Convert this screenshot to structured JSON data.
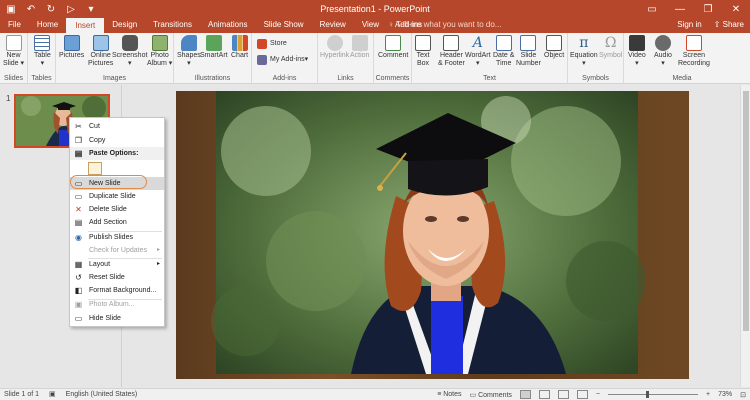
{
  "app": {
    "title": "Presentation1 - PowerPoint",
    "window_controls": [
      "—",
      "❐",
      "✕"
    ],
    "qat_icons": [
      "save-icon",
      "undo-icon",
      "redo-icon",
      "present-icon",
      "customize-icon"
    ]
  },
  "tabs": {
    "items": [
      "File",
      "Home",
      "Insert",
      "Design",
      "Transitions",
      "Animations",
      "Slide Show",
      "Review",
      "View",
      "Add-ins"
    ],
    "active": "Insert",
    "tell_me": "Tell me what you want to do...",
    "sign_in": "Sign in",
    "share": "Share"
  },
  "ribbon": {
    "slides": {
      "label": "Slides",
      "new_slide": "New",
      "new_slide2": "Slide ▾"
    },
    "tables": {
      "label": "Tables",
      "table": "Table",
      "table2": "▾"
    },
    "images": {
      "label": "Images",
      "pictures": "Pictures",
      "online": "Online",
      "online2": "Pictures",
      "screenshot": "Screenshot",
      "screenshot2": "▾",
      "album": "Photo",
      "album2": "Album ▾"
    },
    "illustrations": {
      "label": "Illustrations",
      "shapes": "Shapes",
      "shapes2": "▾",
      "smartart": "SmartArt",
      "chart": "Chart"
    },
    "addins": {
      "label": "Add-ins",
      "store": "Store",
      "myaddins": "My Add-ins"
    },
    "links": {
      "label": "Links",
      "hyperlink": "Hyperlink",
      "action": "Action"
    },
    "comments": {
      "label": "Comments",
      "comment": "Comment"
    },
    "text": {
      "label": "Text",
      "textbox": "Text",
      "textbox2": "Box",
      "header": "Header",
      "header2": "& Footer",
      "wordart": "WordArt",
      "wordart2": "▾",
      "date": "Date &",
      "date2": "Time",
      "slidenum": "Slide",
      "slidenum2": "Number",
      "object": "Object"
    },
    "symbols": {
      "label": "Symbols",
      "equation": "Equation",
      "equation2": "▾",
      "symbol": "Symbol",
      "pi": "π",
      "omega": "Ω"
    },
    "media": {
      "label": "Media",
      "video": "Video",
      "video2": "▾",
      "audio": "Audio",
      "audio2": "▾",
      "screenrec": "Screen",
      "screenrec2": "Recording"
    }
  },
  "thumbnails": {
    "number": "1"
  },
  "context_menu": {
    "items": [
      {
        "label": "Cut",
        "icon": "cut-icon",
        "glyph": "✂",
        "state": "normal"
      },
      {
        "label": "Copy",
        "icon": "copy-icon",
        "glyph": "❐",
        "state": "normal"
      },
      {
        "label": "Paste Options:",
        "icon": "paste-icon",
        "glyph": "📋",
        "state": "header"
      },
      {
        "label": "New Slide",
        "icon": "new-slide-icon",
        "glyph": "▭",
        "state": "highlighted"
      },
      {
        "label": "Duplicate Slide",
        "icon": "duplicate-slide-icon",
        "glyph": "▭",
        "state": "normal"
      },
      {
        "label": "Delete Slide",
        "icon": "delete-slide-icon",
        "glyph": "✕",
        "state": "normal"
      },
      {
        "label": "Add Section",
        "icon": "add-section-icon",
        "glyph": "▤",
        "state": "normal"
      },
      {
        "label": "Publish Slides",
        "icon": "publish-slides-icon",
        "glyph": "◉",
        "state": "normal"
      },
      {
        "label": "Check for Updates",
        "icon": "check-updates-icon",
        "glyph": "",
        "state": "disabled",
        "arrow": "▸"
      },
      {
        "label": "Layout",
        "icon": "layout-icon",
        "glyph": "▦",
        "state": "normal",
        "arrow": "▸"
      },
      {
        "label": "Reset Slide",
        "icon": "reset-slide-icon",
        "glyph": "↺",
        "state": "normal"
      },
      {
        "label": "Format Background...",
        "icon": "format-background-icon",
        "glyph": "◧",
        "state": "normal"
      },
      {
        "label": "Photo Album...",
        "icon": "photo-album-icon",
        "glyph": "▣",
        "state": "disabled"
      },
      {
        "label": "Hide Slide",
        "icon": "hide-slide-icon",
        "glyph": "▭",
        "state": "normal"
      }
    ]
  },
  "status": {
    "slide_info": "Slide 1 of 1",
    "language": "English (United States)",
    "notes": "Notes",
    "comments": "Comments",
    "zoom": "73%"
  },
  "colors": {
    "accent": "#b7472a",
    "highlight_ring": "#e08a4a",
    "thumb_border": "#d24726"
  }
}
